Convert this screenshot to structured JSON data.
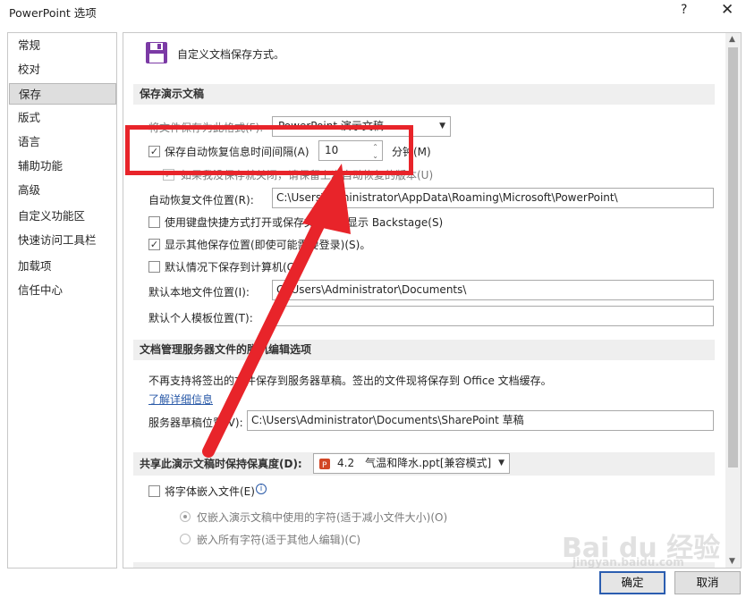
{
  "window": {
    "title": "PowerPoint 选项",
    "help_label": "?",
    "close_label": "✕"
  },
  "sidebar": {
    "items": [
      {
        "label": "常规"
      },
      {
        "label": "校对"
      },
      {
        "label": "保存"
      },
      {
        "label": "版式"
      },
      {
        "label": "语言"
      },
      {
        "label": "辅助功能"
      },
      {
        "label": "高级"
      },
      {
        "label": "自定义功能区"
      },
      {
        "label": "快速访问工具栏"
      },
      {
        "label": "加载项"
      },
      {
        "label": "信任中心"
      }
    ],
    "selected": "保存"
  },
  "header": {
    "icon": "floppy-disk-icon",
    "text": "自定义文档保存方式。"
  },
  "save_section": {
    "title": "保存演示文稿",
    "format_label": "将文件保存为此格式(F):",
    "format_value": "PowerPoint 演示文稿",
    "autorecover_label": "保存自动恢复信息时间间隔(A)",
    "autorecover_checked": true,
    "autorecover_minutes": "10",
    "minutes_label": "分钟(M)",
    "keep_last_label": "如果我没保存就关闭，请保留上次自动恢复的版本(U)",
    "keep_last_checked": true,
    "autorecover_location_label": "自动恢复文件位置(R):",
    "autorecover_location_value": "C:\\Users\\Administrator\\AppData\\Roaming\\Microsoft\\PowerPoint\\",
    "backstage_label": "使用键盘快捷方式打开或保存文件时不显示 Backstage(S)",
    "backstage_checked": false,
    "show_other_label": "显示其他保存位置(即使可能需要登录)(S)。",
    "show_other_checked": true,
    "default_computer_label": "默认情况下保存到计算机(C)",
    "default_computer_checked": false,
    "default_local_label": "默认本地文件位置(I):",
    "default_local_value": "C:\\Users\\Administrator\\Documents\\",
    "personal_template_label": "默认个人模板位置(T):",
    "personal_template_value": ""
  },
  "server_section": {
    "title": "文档管理服务器文件的脱机编辑选项",
    "notice": "不再支持将签出的文件保存到服务器草稿。签出的文件现将保存到 Office 文档缓存。",
    "learn_more": "了解详细信息",
    "drafts_label": "服务器草稿位置(V):",
    "drafts_value": "C:\\Users\\Administrator\\Documents\\SharePoint 草稿"
  },
  "fidelity_section": {
    "title": "共享此演示文稿时保持保真度(D):",
    "file_value": "4.2　气温和降水.ppt[兼容模式]",
    "embed_fonts_label": "将字体嵌入文件(E)",
    "embed_fonts_checked": false,
    "info_icon": "info-icon",
    "embed_used_label": "仅嵌入演示文稿中使用的字符(适于减小文件大小)(O)",
    "embed_all_label": "嵌入所有字符(适于其他人编辑)(C)"
  },
  "footer": {
    "ok_label": "确定",
    "cancel_label": "取消"
  },
  "annotation": {
    "color": "#e8242a"
  },
  "watermark": {
    "brand": "Bai du 经验",
    "url": "jingyan.baidu.com"
  }
}
